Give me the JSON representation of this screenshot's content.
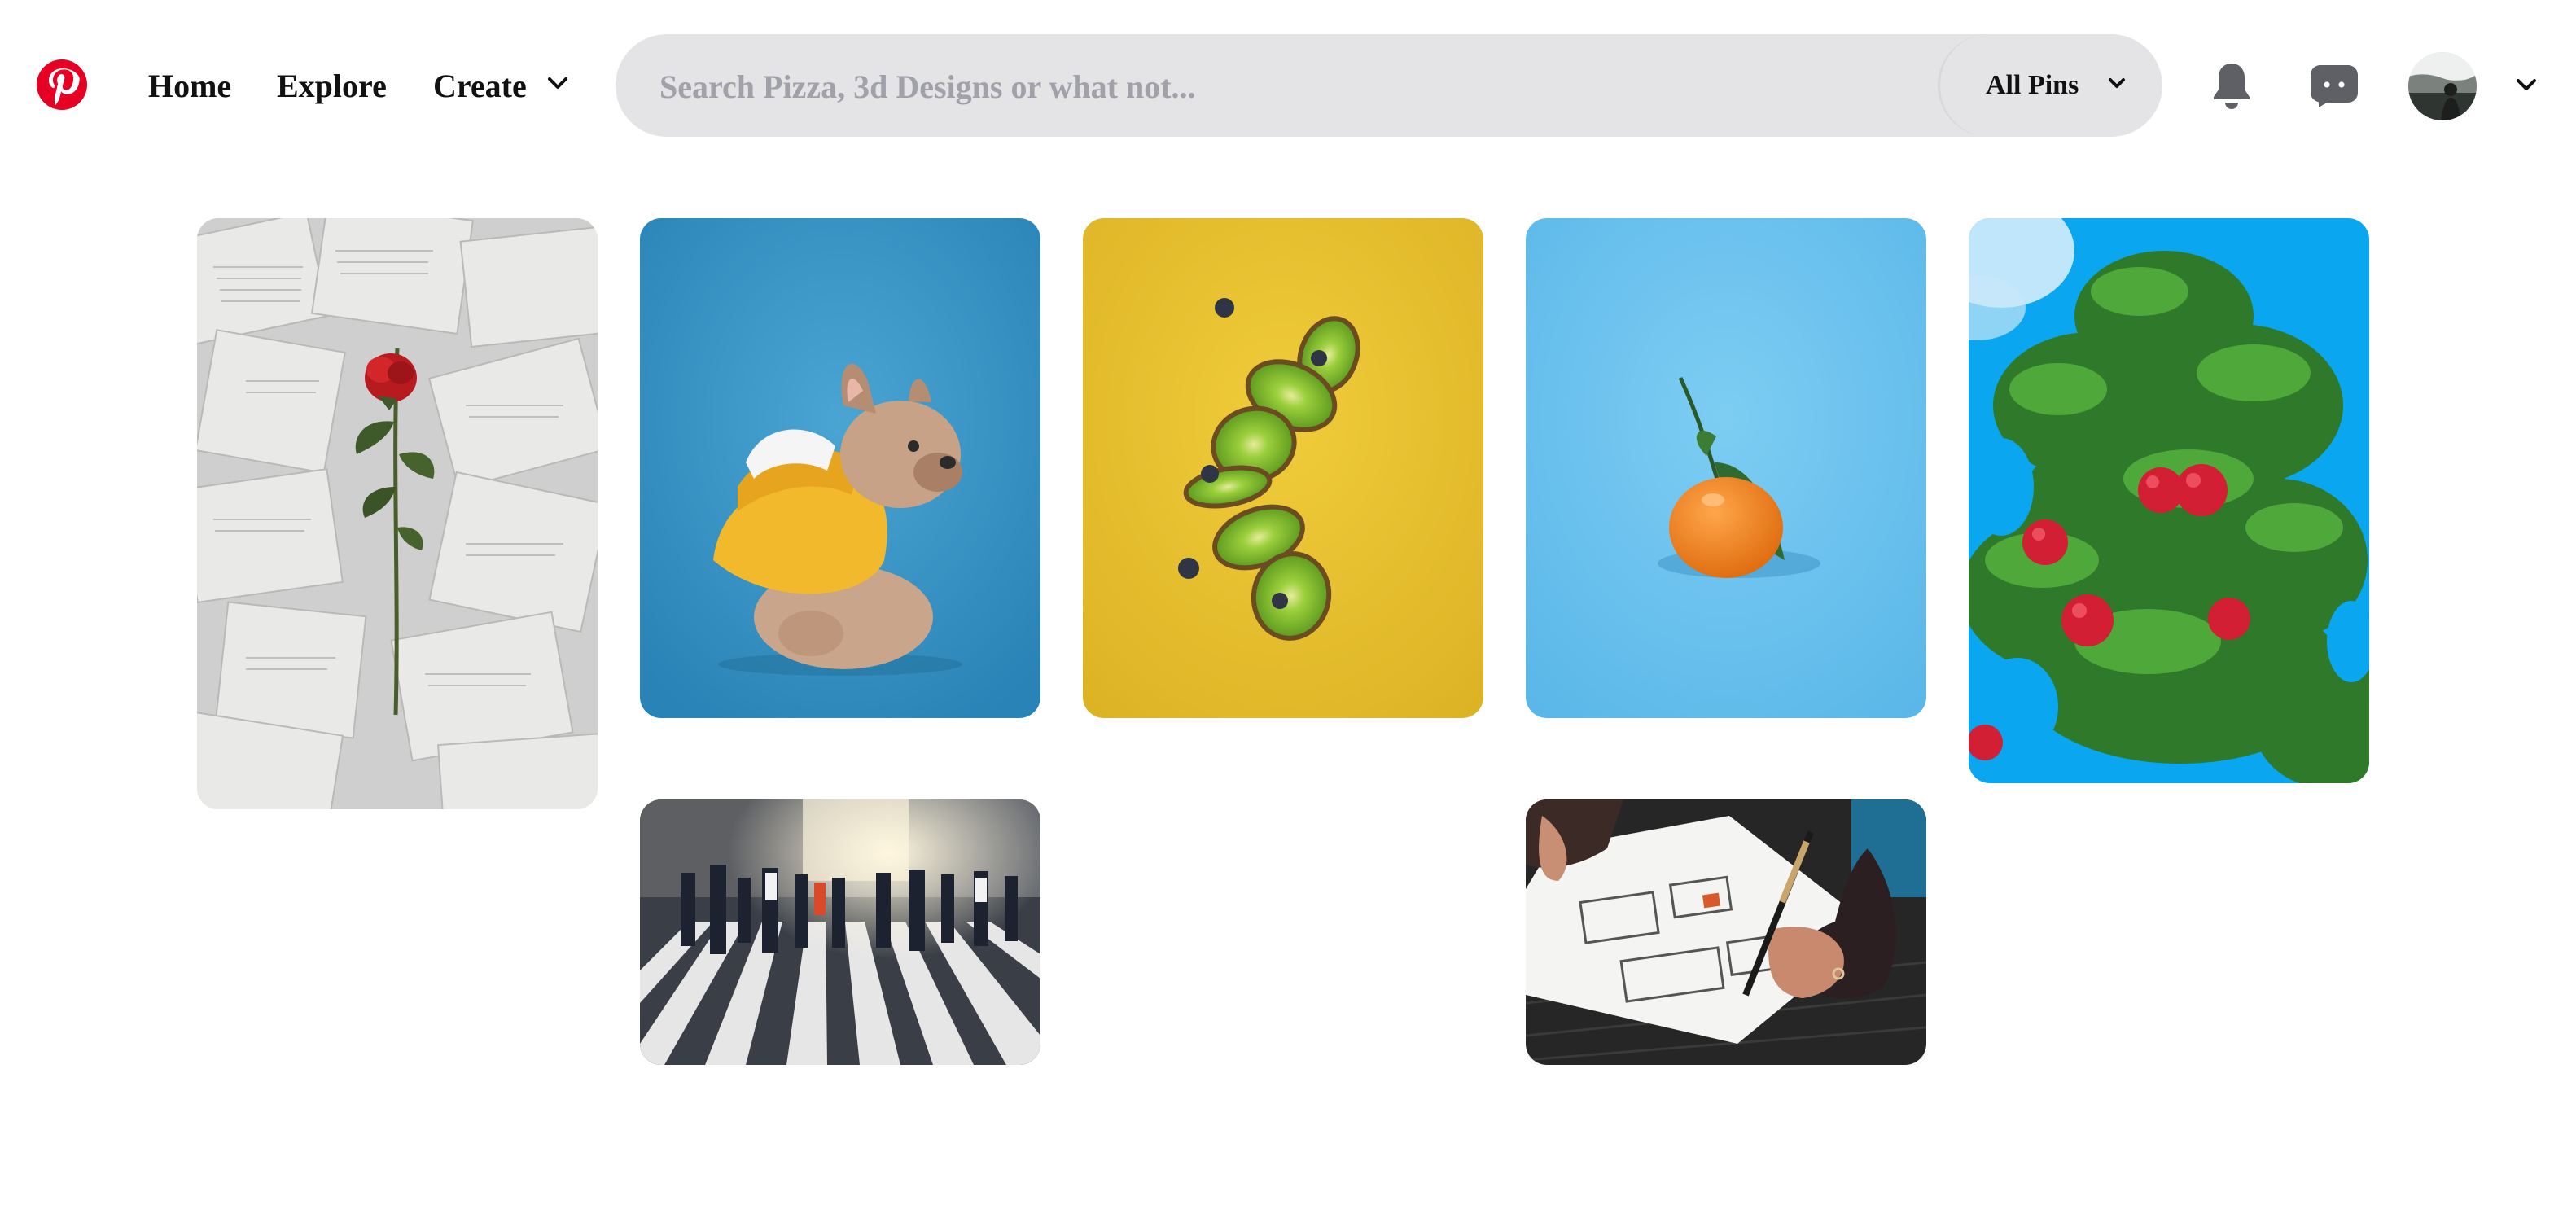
{
  "header": {
    "logo_icon": "pinterest-logo-icon",
    "brand_color": "#e60023",
    "nav": {
      "home_label": "Home",
      "explore_label": "Explore",
      "create_label": "Create"
    },
    "search": {
      "placeholder": "Search Pizza, 3d Designs or what not...",
      "value": "",
      "filter_label": "All Pins"
    },
    "icons": {
      "notifications": "bell-icon",
      "messages": "chat-icon",
      "account_menu": "chevron-down-icon"
    },
    "icon_color": "#5f5f66"
  },
  "pins": [
    {
      "subject": "rose-on-book-pages",
      "background": "#d4d4d4"
    },
    {
      "subject": "french-bulldog-in-hoodie",
      "background": "#3b93c3"
    },
    {
      "subject": "floating-kiwi-slices",
      "background": "#e8c12a"
    },
    {
      "subject": "tangerine-on-blue",
      "background": "#6cc0ec"
    },
    {
      "subject": "apple-tree",
      "background": "#0aa6ef"
    },
    {
      "subject": "pedestrian-crosswalk",
      "background": "#56575a"
    },
    {
      "subject": "hand-sketching-wireframe",
      "background": "#2a2a2a"
    }
  ]
}
